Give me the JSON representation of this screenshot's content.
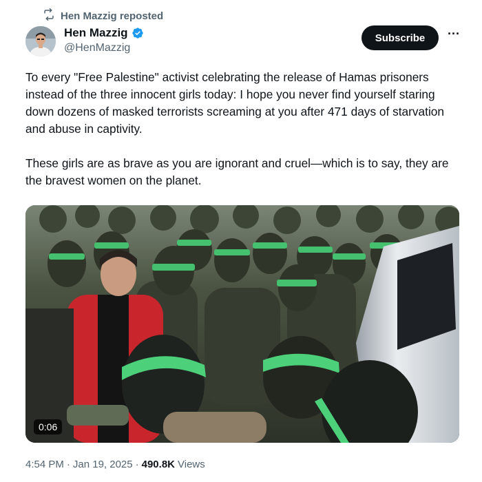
{
  "repost": {
    "icon": "repost-icon",
    "text": "Hen Mazzig reposted"
  },
  "author": {
    "name": "Hen Mazzig",
    "handle": "@HenMazzig",
    "verified": true,
    "verified_color": "#1d9bf0"
  },
  "actions": {
    "subscribe_label": "Subscribe",
    "more_icon": "more-icon"
  },
  "tweet": {
    "paragraph_1": "To every \"Free Palestine\" activist celebrating the release of Hamas prisoners instead of the three innocent girls today: I hope you never find yourself staring down dozens of masked terrorists screaming at you after 471 days of starvation and abuse in captivity.",
    "paragraph_2": "These girls are as brave as you are ignorant and cruel—which is to say, they are the bravest women on the planet."
  },
  "media": {
    "type": "video",
    "duration": "0:06"
  },
  "meta": {
    "time": "4:54 PM",
    "separator_1": "·",
    "date": "Jan 19, 2025",
    "separator_2": "·",
    "views_count": "490.8K",
    "views_label": "Views"
  },
  "colors": {
    "text": "#0f1419",
    "secondary_text": "#536471",
    "subscribe_bg": "#0f1419",
    "headband_green": "#4cd07a",
    "vest_red": "#c8262c"
  }
}
